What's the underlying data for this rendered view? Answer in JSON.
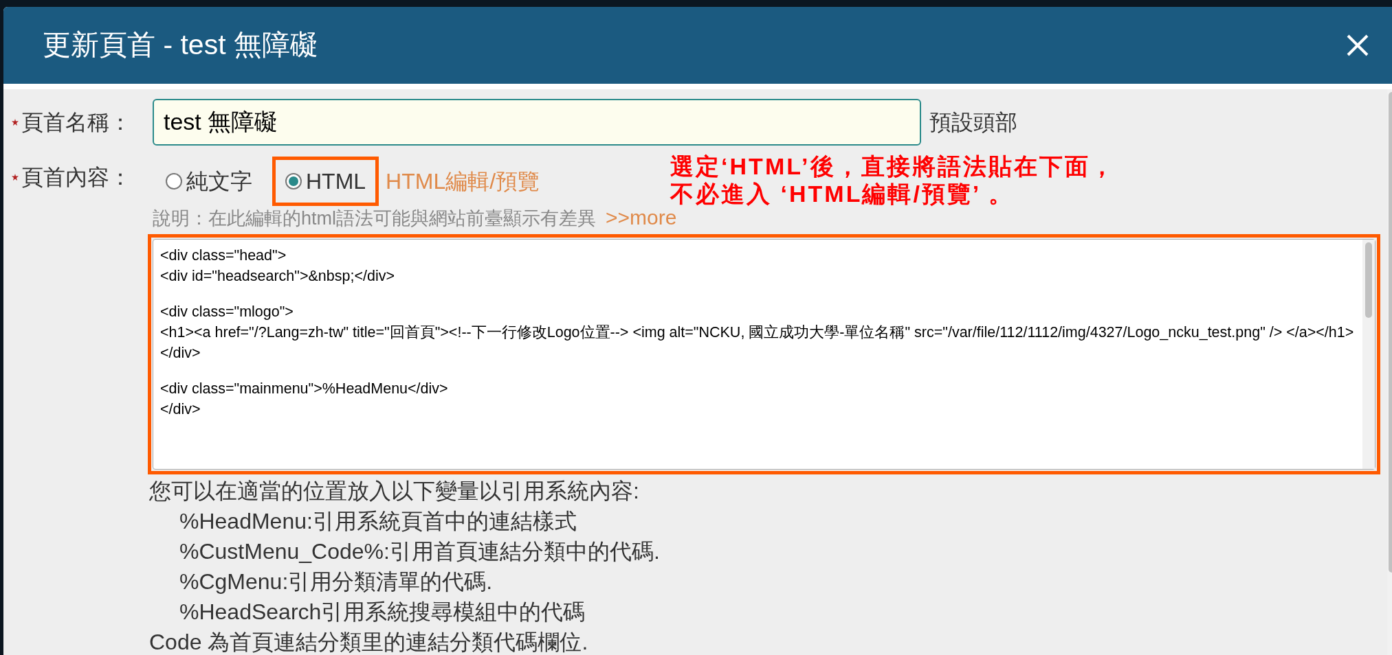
{
  "dialog": {
    "title": "更新頁首 - test 無障礙"
  },
  "name_field": {
    "label": "頁首名稱：",
    "value": "test 無障礙",
    "hint": "預設頭部"
  },
  "content_field": {
    "label": "頁首內容：",
    "options": [
      {
        "label": "純文字",
        "selected": false,
        "highlighted": false
      },
      {
        "label": "HTML",
        "selected": true,
        "highlighted": true
      }
    ],
    "editor_link": "HTML編輯/預覽",
    "annotation": [
      "選定‘HTML’後，直接將語法貼在下面，",
      "不必進入 ‘HTML編輯/預覽’ 。"
    ],
    "note": "說明：在此編輯的html語法可能與網站前臺顯示有差異",
    "more_link": ">>more",
    "code_blocks": [
      [
        "<div class=\"head\">",
        "<div id=\"headsearch\">&nbsp;</div>"
      ],
      [
        "<div class=\"mlogo\">",
        "<h1><a href=\"/?Lang=zh-tw\" title=\"回首頁\"><!--下一行修改Logo位置--> <img alt=\"NCKU, 國立成功大學-單位名稱\" src=\"/var/file/112/1112/img/4327/Logo_ncku_test.png\" /> </a></h1>",
        "</div>"
      ],
      [
        "<div class=\"mainmenu\">%HeadMenu</div>",
        "</div>"
      ]
    ]
  },
  "variables_help": {
    "intro": "您可以在適當的位置放入以下變量以引用系統內容:",
    "items": [
      "%HeadMenu:引用系統頁首中的連結樣式",
      "%CustMenu_Code%:引用首頁連結分類中的代碼.",
      "%CgMenu:引用分類清單的代碼.",
      "%HeadSearch引用系統搜尋模組中的代碼"
    ],
    "footer": "Code 為首頁連結分類里的連結分類代碼欄位."
  }
}
